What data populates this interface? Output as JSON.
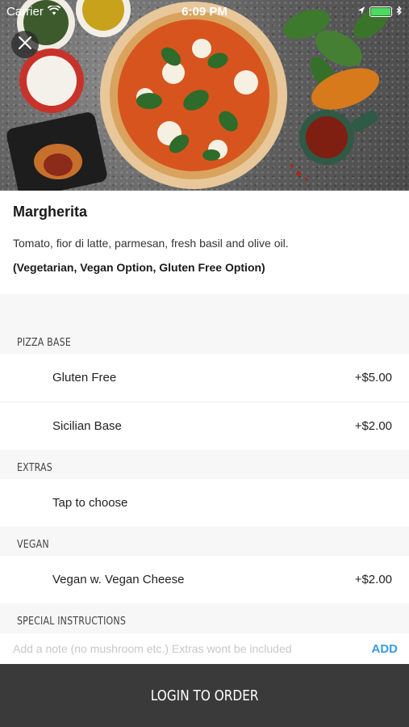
{
  "status_bar": {
    "carrier": "Carrier",
    "time": "6:09 PM"
  },
  "item": {
    "title": "Margherita",
    "description": "Tomato, fior di latte, parmesan, fresh basil and olive oil.",
    "dietary": "(Vegetarian, Vegan Option, Gluten Free Option)"
  },
  "sections": {
    "pizza_base": {
      "label": "PIZZA BASE",
      "options": [
        {
          "name": "Gluten Free",
          "price": "+$5.00"
        },
        {
          "name": "Sicilian Base",
          "price": "+$2.00"
        }
      ]
    },
    "extras": {
      "label": "EXTRAS",
      "choose_label": "Tap to choose"
    },
    "vegan": {
      "label": "VEGAN",
      "options": [
        {
          "name": "Vegan w. Vegan Cheese",
          "price": "+$2.00"
        }
      ]
    },
    "special_instructions": {
      "label": "SPECIAL INSTRUCTIONS",
      "placeholder": "Add a note (no mushroom etc.) Extras wont be included",
      "add_label": "ADD"
    }
  },
  "order_button": {
    "label": "LOGIN TO ORDER"
  },
  "colors": {
    "accent": "#3a9be0",
    "order_bar": "#3a3a3a",
    "battery": "#4cd964"
  },
  "icons": {
    "close": "close-icon",
    "wifi": "wifi-icon",
    "battery": "battery-icon",
    "location": "location-arrow-icon",
    "bluetooth": "bluetooth-icon"
  }
}
